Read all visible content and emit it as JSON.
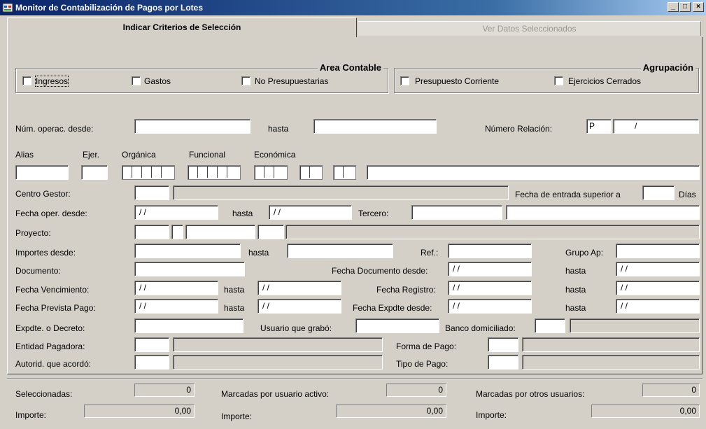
{
  "window": {
    "title": "Monitor de Contabilización de Pagos por Lotes",
    "min": "_",
    "max": "□",
    "close": "×"
  },
  "tabs": {
    "active": "Indicar Criterios de Selección",
    "inactive": "Ver Datos Seleccionados"
  },
  "area_contable": {
    "title": "Area Contable",
    "ingresos": "Ingresos",
    "gastos": "Gastos",
    "no_presupuestarias": "No Presupuestarias"
  },
  "agrupacion": {
    "title": "Agrupación",
    "presupuesto_corriente": "Presupuesto Corriente",
    "ejercicios_cerrados": "Ejercicios Cerrados"
  },
  "labels": {
    "num_operac_desde": "Núm. operac. desde:",
    "hasta": "hasta",
    "numero_relacion": "Número Relación:",
    "alias": "Alias",
    "ejer": "Ejer.",
    "organica": "Orgánica",
    "funcional": "Funcional",
    "economica": "Económica",
    "centro_gestor": "Centro Gestor:",
    "fecha_entrada_superior": "Fecha de entrada superior a",
    "dias": "Días",
    "fecha_oper_desde": "Fecha oper. desde:",
    "tercero": "Tercero:",
    "proyecto": "Proyecto:",
    "importes_desde": "Importes desde:",
    "ref": "Ref.:",
    "grupo_ap": "Grupo Ap:",
    "documento": "Documento:",
    "fecha_documento_desde": "Fecha Documento desde:",
    "fecha_vencimiento": "Fecha Vencimiento:",
    "fecha_registro": "Fecha Registro:",
    "fecha_prevista_pago": "Fecha Prevista Pago:",
    "fecha_expdte_desde": "Fecha Expdte desde:",
    "expdte_decreto": "Expdte. o Decreto:",
    "usuario_grabo": "Usuario que grabó:",
    "banco_domiciliado": "Banco domiciliado:",
    "entidad_pagadora": "Entidad Pagadora:",
    "forma_pago": "Forma de Pago:",
    "autorid_acordo": "Autorid. que acordó:",
    "tipo_pago": "Tipo de Pago:"
  },
  "values": {
    "relacion_prefix": "P",
    "relacion_slash": "/",
    "date_empty": "/ /"
  },
  "summary": {
    "seleccionadas": "Seleccionadas:",
    "marcadas_usuario": "Marcadas por usuario activo:",
    "marcadas_otros": "Marcadas por otros usuarios:",
    "importe": "Importe:",
    "count_sel": "0",
    "count_usr": "0",
    "count_otr": "0",
    "imp_sel": "0,00",
    "imp_usr": "0,00",
    "imp_otr": "0,00"
  }
}
